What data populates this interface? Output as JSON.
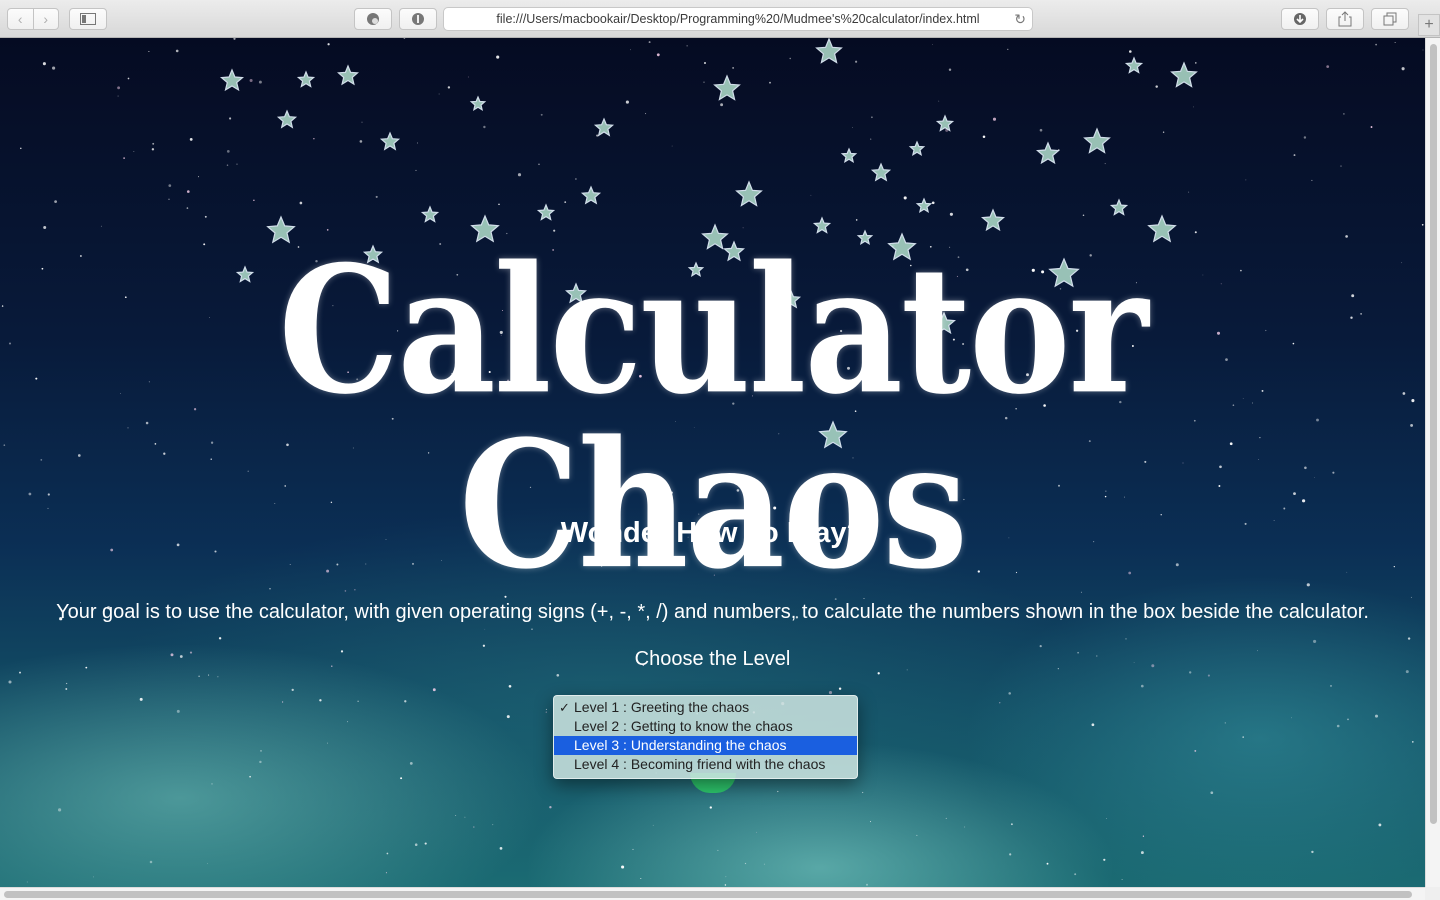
{
  "browser": {
    "url": "file:///Users/macbookair/Desktop/Programming%20/Mudmee's%20calculator/index.html",
    "back_icon": "chevron-left-icon",
    "forward_icon": "chevron-right-icon",
    "new_tab_symbol": "+"
  },
  "page": {
    "logo_text": "Calculator Chaos",
    "heading": "Wonder How To Play?",
    "instructions": "Your goal is to use the calculator, with given operating signs (+, -, *, /) and numbers, to calculate the numbers shown in the box beside the calculator.",
    "choose_label": "Choose the Level",
    "levels": [
      {
        "label": "Level 1 : Greeting the chaos",
        "checked": true,
        "highlighted": false
      },
      {
        "label": "Level 2 : Getting to know the chaos",
        "checked": false,
        "highlighted": false
      },
      {
        "label": "Level 3 : Understanding the chaos",
        "checked": false,
        "highlighted": true
      },
      {
        "label": "Level 4 : Becoming friend with the chaos",
        "checked": false,
        "highlighted": false
      }
    ],
    "checkmark": "✓",
    "highlight_color": "#1a5fe0"
  }
}
